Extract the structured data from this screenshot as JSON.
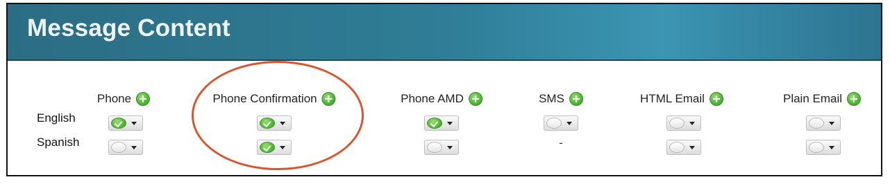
{
  "header": {
    "title": "Message Content"
  },
  "languages": [
    "English",
    "Spanish"
  ],
  "columns": [
    {
      "label": "Phone",
      "english": "on",
      "spanish": "off"
    },
    {
      "label": "Phone Confirmation",
      "english": "on",
      "spanish": "on"
    },
    {
      "label": "Phone AMD",
      "english": "on",
      "spanish": "off"
    },
    {
      "label": "SMS",
      "english": "off",
      "spanish": "-"
    },
    {
      "label": "HTML Email",
      "english": "off",
      "spanish": "off"
    },
    {
      "label": "Plain Email",
      "english": "off",
      "spanish": "off"
    }
  ],
  "colors": {
    "header_bg": "#2f7d96",
    "accent_green": "#53b83a",
    "highlight": "#d9552e"
  },
  "icons": {
    "add": "plus-circle-icon",
    "enabled": "check-circle-icon",
    "disabled": "empty-circle-icon",
    "dropdown": "caret-down-icon"
  }
}
